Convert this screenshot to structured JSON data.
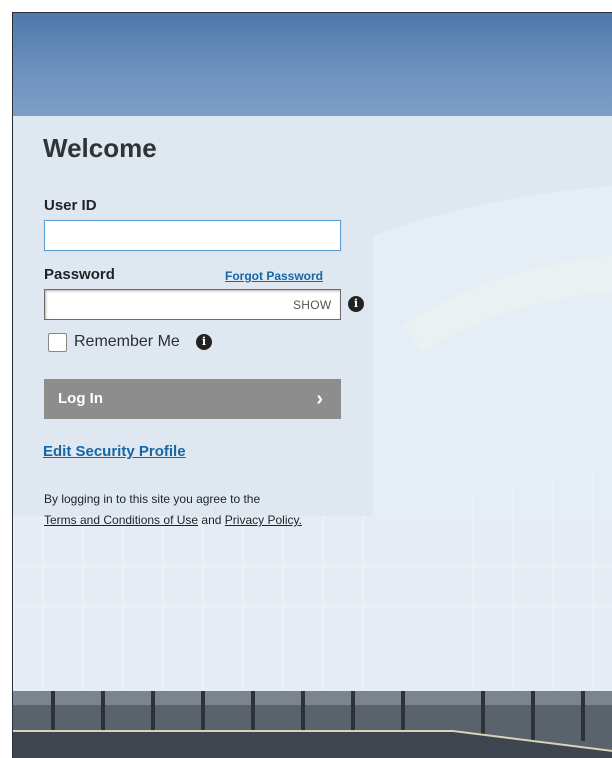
{
  "login": {
    "title": "Welcome",
    "user_id_label": "User ID",
    "user_id_value": "",
    "password_label": "Password",
    "password_value": "",
    "forgot_password": "Forgot Password",
    "show_label": "SHOW",
    "remember_me": "Remember Me",
    "remember_checked": false,
    "login_button": "Log In",
    "edit_security_profile": "Edit Security Profile",
    "legal_prefix": "By logging in to this site you agree to the",
    "terms_link": "Terms and Conditions of Use",
    "and_text": "and",
    "privacy_link": "Privacy Policy."
  },
  "icons": {
    "info": "info-circle-icon",
    "chevron": "chevron-right-icon"
  },
  "colors": {
    "link": "#1567a6",
    "button_bg": "#8d8d8d",
    "focus_border": "#5b9fd6",
    "panel": "#e8f0f8"
  }
}
